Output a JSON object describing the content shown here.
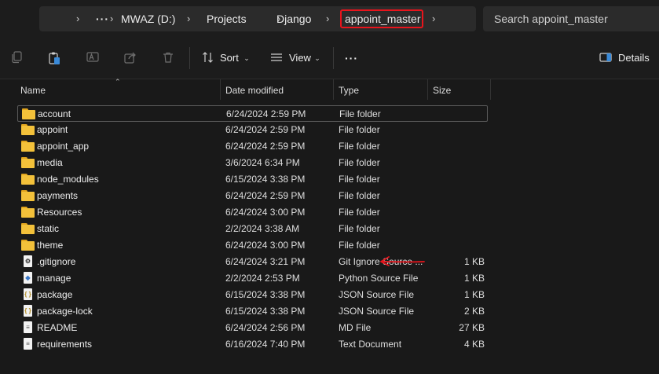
{
  "address": {
    "breadcrumbs": [
      "MWAZ (D:)",
      "Projects",
      "Django",
      "appoint_master"
    ],
    "more_label": "···",
    "separator": "›"
  },
  "search": {
    "placeholder": "Search appoint_master"
  },
  "toolbar": {
    "sort_label": "Sort",
    "view_label": "View",
    "more_label": "···",
    "details_label": "Details"
  },
  "columns": {
    "name": "Name",
    "date": "Date modified",
    "type": "Type",
    "size": "Size"
  },
  "files": [
    {
      "name": "account",
      "date": "6/24/2024 2:59 PM",
      "type": "File folder",
      "size": "",
      "icon": "folder-icon"
    },
    {
      "name": "appoint",
      "date": "6/24/2024 2:59 PM",
      "type": "File folder",
      "size": "",
      "icon": "folder-icon"
    },
    {
      "name": "appoint_app",
      "date": "6/24/2024 2:59 PM",
      "type": "File folder",
      "size": "",
      "icon": "folder-icon"
    },
    {
      "name": "media",
      "date": "3/6/2024 6:34 PM",
      "type": "File folder",
      "size": "",
      "icon": "folder-icon"
    },
    {
      "name": "node_modules",
      "date": "6/15/2024 3:38 PM",
      "type": "File folder",
      "size": "",
      "icon": "folder-icon"
    },
    {
      "name": "payments",
      "date": "6/24/2024 2:59 PM",
      "type": "File folder",
      "size": "",
      "icon": "folder-icon"
    },
    {
      "name": "Resources",
      "date": "6/24/2024 3:00 PM",
      "type": "File folder",
      "size": "",
      "icon": "folder-icon"
    },
    {
      "name": "static",
      "date": "2/2/2024 3:38 AM",
      "type": "File folder",
      "size": "",
      "icon": "folder-icon"
    },
    {
      "name": "theme",
      "date": "6/24/2024 3:00 PM",
      "type": "File folder",
      "size": "",
      "icon": "folder-icon"
    },
    {
      "name": ".gitignore",
      "date": "6/24/2024 3:21 PM",
      "type": "Git Ignore Source ...",
      "size": "1 KB",
      "icon": "gitignore-file-icon"
    },
    {
      "name": "manage",
      "date": "2/2/2024 2:53 PM",
      "type": "Python Source File",
      "size": "1 KB",
      "icon": "python-file-icon"
    },
    {
      "name": "package",
      "date": "6/15/2024 3:38 PM",
      "type": "JSON Source File",
      "size": "1 KB",
      "icon": "json-file-icon"
    },
    {
      "name": "package-lock",
      "date": "6/15/2024 3:38 PM",
      "type": "JSON Source File",
      "size": "2 KB",
      "icon": "json-file-icon"
    },
    {
      "name": "README",
      "date": "6/24/2024 2:56 PM",
      "type": "MD File",
      "size": "27 KB",
      "icon": "markdown-file-icon"
    },
    {
      "name": "requirements",
      "date": "6/16/2024 7:40 PM",
      "type": "Text Document",
      "size": "4 KB",
      "icon": "text-file-icon"
    }
  ],
  "colors": {
    "folder": "#f3c13a",
    "annotation": "#e8141c",
    "background": "#191919"
  }
}
